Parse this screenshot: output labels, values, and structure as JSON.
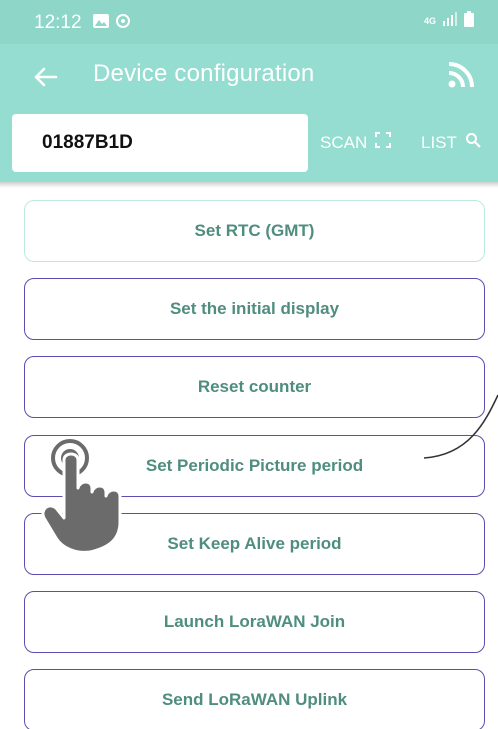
{
  "status_bar": {
    "time": "12:12",
    "network": "4G"
  },
  "app_bar": {
    "title": "Device configuration"
  },
  "search": {
    "value": "01887B1D",
    "scan_label": "SCAN",
    "list_label": "LIST"
  },
  "buttons": [
    {
      "label": "Set RTC (GMT)"
    },
    {
      "label": "Set the initial display"
    },
    {
      "label": "Reset counter"
    },
    {
      "label": "Set Periodic Picture period"
    },
    {
      "label": "Set Keep Alive period"
    },
    {
      "label": "Launch LoraWAN Join"
    },
    {
      "label": "Send LoRaWAN Uplink"
    }
  ],
  "colors": {
    "app_bar": "#94ddd0",
    "status_bar": "#8ed6c8",
    "button_text": "#4f8d7f",
    "button_border": "#5a4fb0"
  },
  "icons": [
    "back-arrow-icon",
    "rss-icon",
    "scan-icon",
    "search-icon",
    "image-icon",
    "sync-icon",
    "signal-icon",
    "battery-icon",
    "pointer-hand-icon"
  ]
}
